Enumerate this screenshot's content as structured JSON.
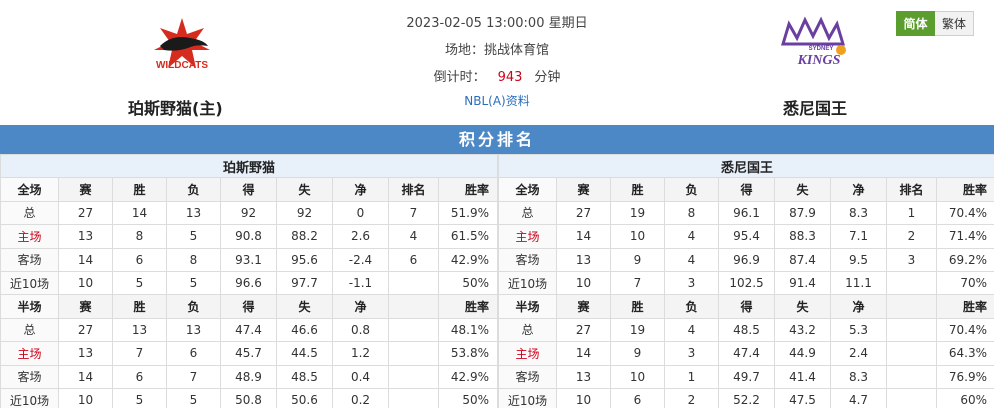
{
  "match": {
    "datetime": "2023-02-05 13:00:00 星期日",
    "venue": "场地：挑战体育馆",
    "countdown_label": "倒计时：",
    "countdown_value": "943",
    "countdown_unit": "分钟",
    "league_link": "NBL(A)资料"
  },
  "home_team": {
    "name": "珀斯野猫(主)",
    "logo_text": "WILDCATS"
  },
  "away_team": {
    "name": "悉尼国王",
    "logo_text": "KINGS",
    "logo_small": "SYDNEY"
  },
  "lang": {
    "simplified": "简体",
    "traditional": "繁体"
  },
  "section_title": "积分排名",
  "columns_full": [
    "全场",
    "赛",
    "胜",
    "负",
    "得",
    "失",
    "净",
    "排名",
    "胜率"
  ],
  "columns_half": [
    "半场",
    "赛",
    "胜",
    "负",
    "得",
    "失",
    "净",
    "",
    "胜率"
  ],
  "tables": [
    {
      "team": "珀斯野猫",
      "full": [
        [
          "总",
          "27",
          "14",
          "13",
          "92",
          "92",
          "0",
          "7",
          "51.9%"
        ],
        [
          "主场",
          "13",
          "8",
          "5",
          "90.8",
          "88.2",
          "2.6",
          "4",
          "61.5%"
        ],
        [
          "客场",
          "14",
          "6",
          "8",
          "93.1",
          "95.6",
          "-2.4",
          "6",
          "42.9%"
        ],
        [
          "近10场",
          "10",
          "5",
          "5",
          "96.6",
          "97.7",
          "-1.1",
          "",
          "50%"
        ]
      ],
      "half": [
        [
          "总",
          "27",
          "13",
          "13",
          "47.4",
          "46.6",
          "0.8",
          "",
          "48.1%"
        ],
        [
          "主场",
          "13",
          "7",
          "6",
          "45.7",
          "44.5",
          "1.2",
          "",
          "53.8%"
        ],
        [
          "客场",
          "14",
          "6",
          "7",
          "48.9",
          "48.5",
          "0.4",
          "",
          "42.9%"
        ],
        [
          "近10场",
          "10",
          "5",
          "5",
          "50.8",
          "50.6",
          "0.2",
          "",
          "50%"
        ]
      ]
    },
    {
      "team": "悉尼国王",
      "full": [
        [
          "总",
          "27",
          "19",
          "8",
          "96.1",
          "87.9",
          "8.3",
          "1",
          "70.4%"
        ],
        [
          "主场",
          "14",
          "10",
          "4",
          "95.4",
          "88.3",
          "7.1",
          "2",
          "71.4%"
        ],
        [
          "客场",
          "13",
          "9",
          "4",
          "96.9",
          "87.4",
          "9.5",
          "3",
          "69.2%"
        ],
        [
          "近10场",
          "10",
          "7",
          "3",
          "102.5",
          "91.4",
          "11.1",
          "",
          "70%"
        ]
      ],
      "half": [
        [
          "总",
          "27",
          "19",
          "4",
          "48.5",
          "43.2",
          "5.3",
          "",
          "70.4%"
        ],
        [
          "主场",
          "14",
          "9",
          "3",
          "47.4",
          "44.9",
          "2.4",
          "",
          "64.3%"
        ],
        [
          "客场",
          "13",
          "10",
          "1",
          "49.7",
          "41.4",
          "8.3",
          "",
          "76.9%"
        ],
        [
          "近10场",
          "10",
          "6",
          "2",
          "52.2",
          "47.5",
          "4.7",
          "",
          "60%"
        ]
      ]
    }
  ],
  "colors": {
    "title_bar": "#4d88c6",
    "home_red": "#d0021b",
    "lang_active": "#5b9e2f",
    "link": "#2a6ebb"
  }
}
